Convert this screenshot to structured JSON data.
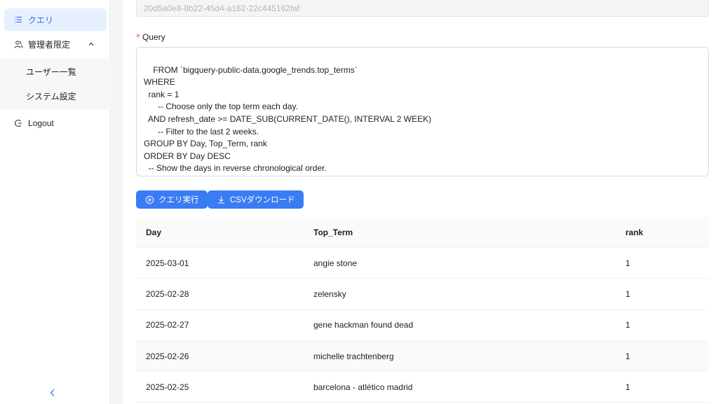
{
  "sidebar": {
    "items": [
      {
        "label": "クエリ",
        "icon": "list-icon",
        "active": true
      },
      {
        "label": "管理者限定",
        "icon": "admin-users-icon",
        "expanded": true
      },
      {
        "label": "ユーザー一覧"
      },
      {
        "label": "システム設定"
      },
      {
        "label": "Logout",
        "icon": "logout-icon"
      }
    ],
    "collapse_icon": "chevron-left-icon"
  },
  "form": {
    "id_value": "20d5a0e8-8b22-45d4-a162-22c445162faf",
    "query_label": "Query",
    "required_mark": "*",
    "query_text": "FROM `bigquery-public-data.google_trends.top_terms`\nWHERE\n  rank = 1\n      -- Choose only the top term each day.\n  AND refresh_date >= DATE_SUB(CURRENT_DATE(), INTERVAL 2 WEEK)\n      -- Filter to the last 2 weeks.\nGROUP BY Day, Top_Term, rank\nORDER BY Day DESC\n  -- Show the days in reverse chronological order."
  },
  "actions": {
    "run_label": "クエリ実行",
    "download_label": "CSVダウンロード"
  },
  "table": {
    "headers": [
      "Day",
      "Top_Term",
      "rank"
    ],
    "rows": [
      [
        "2025-03-01",
        "angie stone",
        "1"
      ],
      [
        "2025-02-28",
        "zelensky",
        "1"
      ],
      [
        "2025-02-27",
        "gene hackman found dead",
        "1"
      ],
      [
        "2025-02-26",
        "michelle trachtenberg",
        "1"
      ],
      [
        "2025-02-25",
        "barcelona - atlético madrid",
        "1"
      ]
    ]
  },
  "colors": {
    "accent": "#3b7cf5",
    "active_bg": "#e6f0ff",
    "required": "#ff4d4f"
  }
}
